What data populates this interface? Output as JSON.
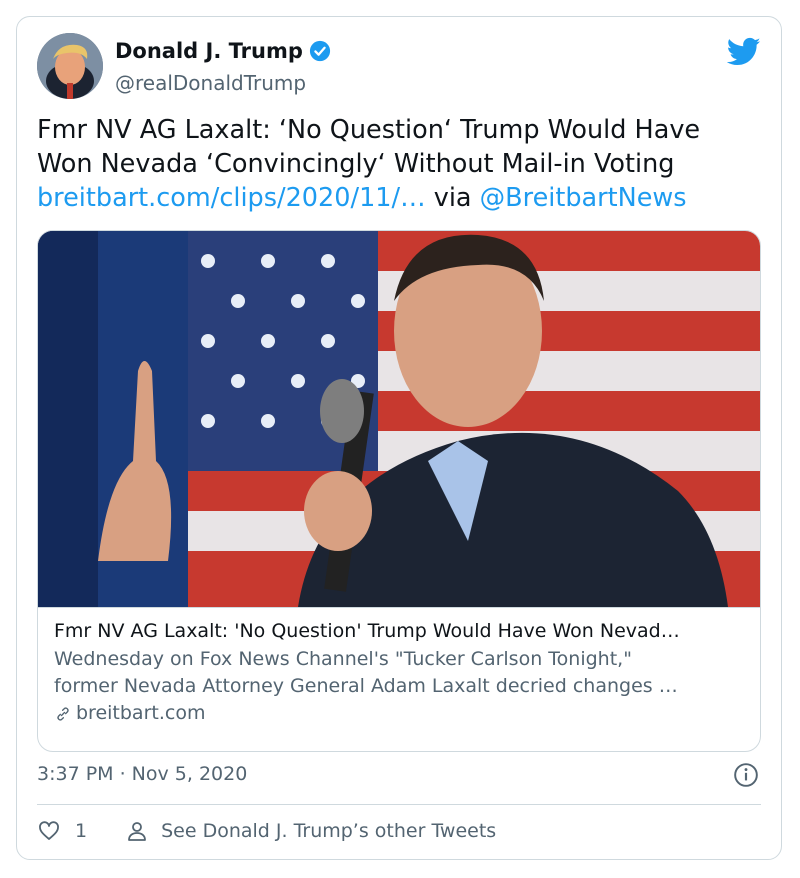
{
  "author": {
    "display_name": "Donald J. Trump",
    "handle": "@realDonaldTrump",
    "verified": true
  },
  "tweet": {
    "line1": "Fmr NV AG Laxalt: ‘No Question‘ Trump Would Have",
    "line2": "Won Nevada ‘Convincingly‘ Without Mail-in Voting",
    "url": "breitbart.com/clips/2020/11/…",
    "via": "via",
    "mention": "@BreitbartNews"
  },
  "link_card": {
    "title": "Fmr NV AG Laxalt: 'No Question' Trump Would Have Won Nevad…",
    "description_line1": "Wednesday on Fox News Channel's \"Tucker Carlson Tonight,\"",
    "description_line2": "former Nevada Attorney General Adam Laxalt decried changes …",
    "domain": "breitbart.com"
  },
  "timestamp": "3:37 PM · Nov 5, 2020",
  "actions": {
    "like_count": "1",
    "other_tweets_label": "See Donald J. Trump’s other Tweets"
  },
  "colors": {
    "link_blue": "#1d9bf0",
    "muted_gray": "#536471",
    "border": "#cfd9de",
    "text": "#0f1419"
  },
  "icons": [
    "verified-badge-icon",
    "twitter-bird-icon",
    "link-icon",
    "info-icon",
    "heart-icon",
    "person-icon"
  ]
}
